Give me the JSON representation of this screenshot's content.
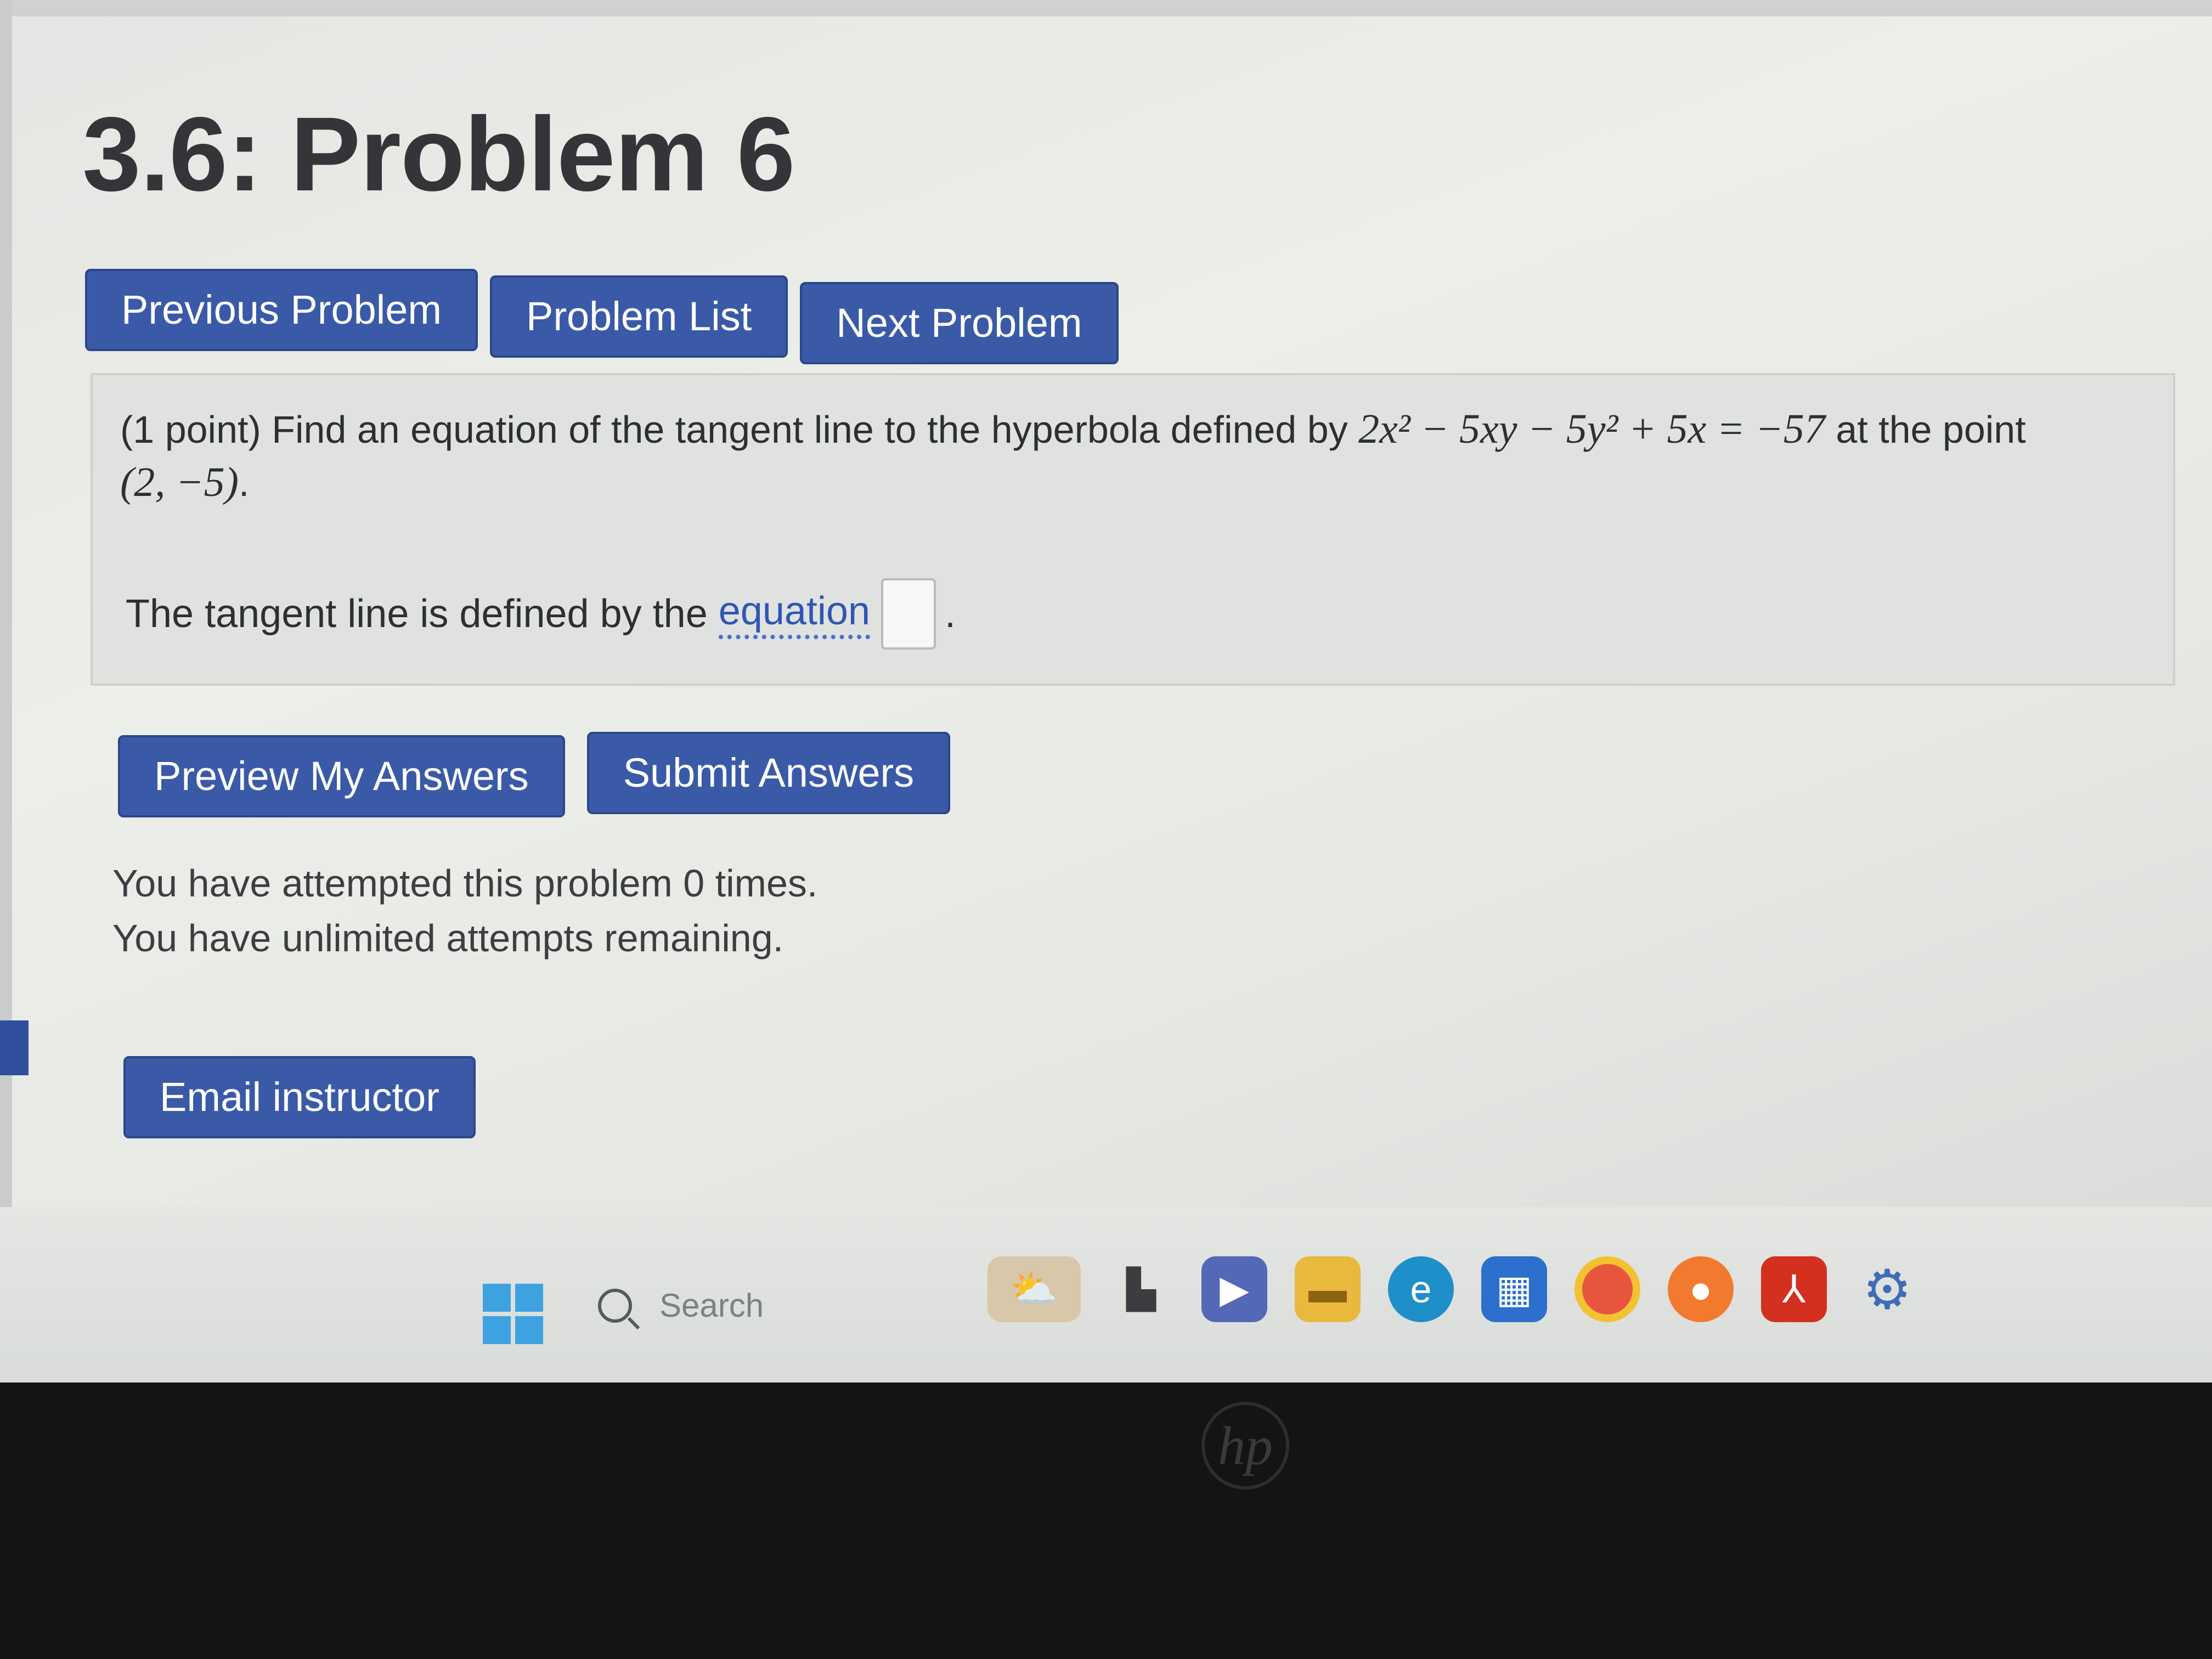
{
  "page": {
    "title": "3.6: Problem 6"
  },
  "nav": {
    "previous_label": "Previous Problem",
    "list_label": "Problem List",
    "next_label": "Next Problem"
  },
  "problem": {
    "intro": "(1 point) Find an equation of the tangent line to the hyperbola defined by",
    "equation": "2x² − 5xy − 5y² + 5x = −57",
    "point_prefix": "at the point",
    "point": "(2, −5)",
    "point_suffix": ".",
    "answer_prefix": "The tangent line is defined by the",
    "answer_link": "equation",
    "answer_value": "",
    "answer_suffix": "."
  },
  "actions": {
    "preview_label": "Preview My Answers",
    "submit_label": "Submit Answers"
  },
  "attempts": {
    "line1": "You have attempted this problem 0 times.",
    "line2": "You have unlimited attempts remaining."
  },
  "email": {
    "label": "Email instructor"
  },
  "taskbar": {
    "search_placeholder": "Search",
    "icons": [
      "start-icon",
      "widgets-icon",
      "task-view-icon",
      "chat-icon",
      "file-explorer-icon",
      "edge-icon",
      "store-icon",
      "chrome-icon",
      "firefox-icon",
      "acrobat-icon",
      "settings-icon"
    ]
  },
  "colors": {
    "button": "#3a5aa8",
    "link": "#2f56b5",
    "problem_bg": "#dfe2df"
  }
}
